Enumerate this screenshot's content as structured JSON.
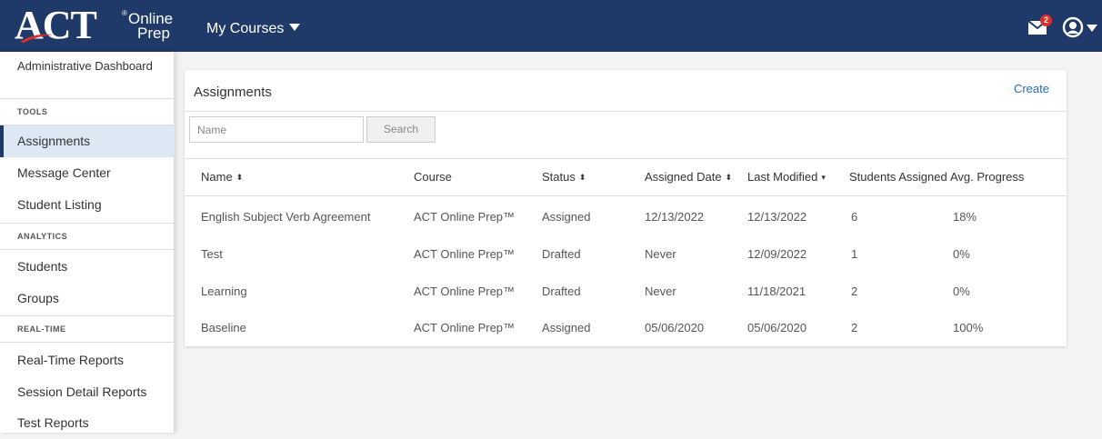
{
  "header": {
    "logo_text": "ACT",
    "logo_reg": "®",
    "logo_online": "Online",
    "logo_prep": "Prep",
    "courses_label": "My Courses",
    "mail_count": "2",
    "brand_color": "#1f3a68"
  },
  "sidebar": {
    "dashboard": "Administrative Dashboard",
    "sections": [
      {
        "heading": "TOOLS",
        "items": [
          "Assignments",
          "Message Center",
          "Student Listing"
        ]
      },
      {
        "heading": "ANALYTICS",
        "items": [
          "Students",
          "Groups"
        ]
      },
      {
        "heading": "REAL-TIME",
        "items": [
          "Real-Time Reports",
          "Session Detail Reports",
          "Test Reports"
        ]
      }
    ],
    "active_item": "Assignments"
  },
  "panel": {
    "title": "Assignments",
    "create_label": "Create",
    "search_placeholder": "Name",
    "search_button": "Search"
  },
  "table": {
    "columns": [
      "Name",
      "Course",
      "Status",
      "Assigned Date",
      "Last Modified",
      "Students Assigned",
      "Avg. Progress"
    ],
    "sort_icons": [
      "⬍",
      "",
      "⬍",
      "⬍",
      "▾",
      "",
      ""
    ],
    "rows": [
      [
        "English Subject Verb Agreement",
        "ACT Online Prep™",
        "Assigned",
        "12/13/2022",
        "12/13/2022",
        "6",
        "18%"
      ],
      [
        "Test",
        "ACT Online Prep™",
        "Drafted",
        "Never",
        "12/09/2022",
        "1",
        "0%"
      ],
      [
        "Learning",
        "ACT Online Prep™",
        "Drafted",
        "Never",
        "11/18/2021",
        "2",
        "0%"
      ],
      [
        "Baseline",
        "ACT Online Prep™",
        "Assigned",
        "05/06/2020",
        "05/06/2020",
        "2",
        "100%"
      ]
    ]
  }
}
